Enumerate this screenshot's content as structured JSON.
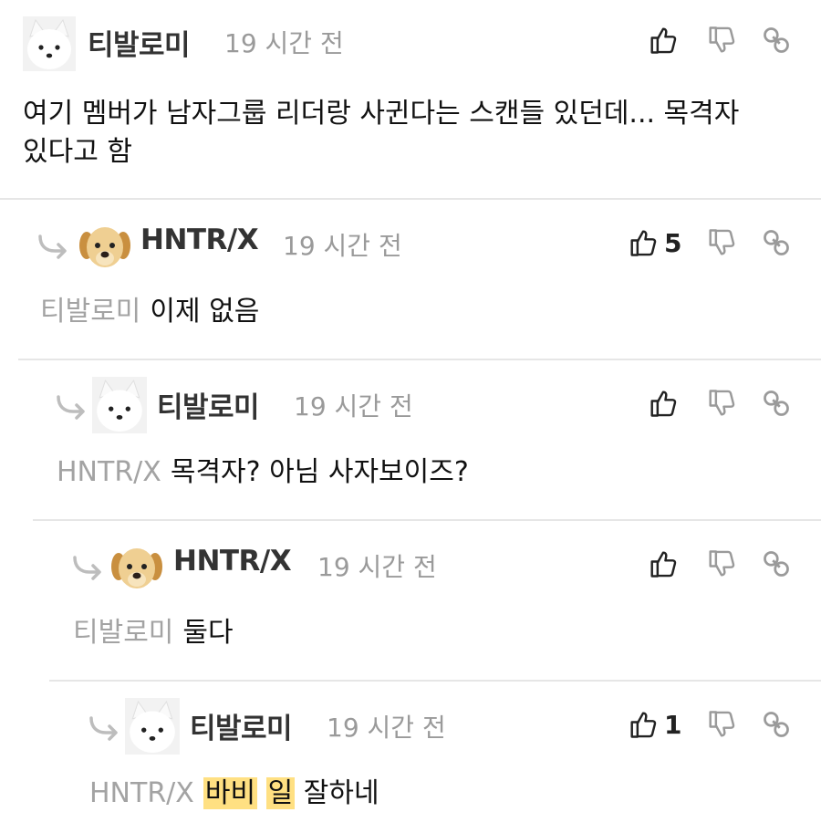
{
  "comments": [
    {
      "username": "티발로미",
      "time": "19 시간 전",
      "avatar": "fox-avatar",
      "text_line1": "여기 멤버가 남자그룹 리더랑 사귄다는 스캔들 있던데... 목격자",
      "text_line2": "있다고 함",
      "likes": ""
    },
    {
      "username": "HNTR/X",
      "time": "19 시간 전",
      "avatar": "puppy-avatar",
      "mention": "티발로미",
      "text": "이제 없음",
      "likes": "5"
    },
    {
      "username": "티발로미",
      "time": "19 시간 전",
      "avatar": "fox-avatar",
      "mention": "HNTR/X",
      "text": "목격자? 아님 사자보이즈?",
      "likes": ""
    },
    {
      "username": "HNTR/X",
      "time": "19 시간 전",
      "avatar": "puppy-avatar",
      "mention": "티발로미",
      "text": "둘다",
      "likes": ""
    },
    {
      "username": "티발로미",
      "time": "19 시간 전",
      "avatar": "fox-avatar",
      "mention": "HNTR/X",
      "highlight1": "바비",
      "highlight2": "일",
      "text": "잘하네",
      "likes": "1"
    }
  ],
  "icons": {
    "like": "thumbs-up-icon",
    "dislike": "thumbs-down-icon",
    "link": "link-icon",
    "reply": "reply-arrow-icon"
  },
  "colors": {
    "mention": "#a3a3a3",
    "time": "#9a9a9a",
    "highlight": "#ffe082",
    "divider": "#e6e6e6"
  }
}
